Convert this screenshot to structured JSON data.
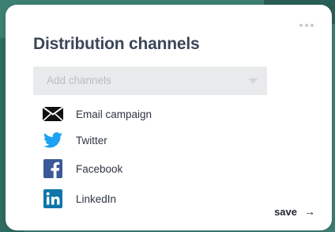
{
  "card": {
    "title": "Distribution channels"
  },
  "select": {
    "placeholder": "Add channels"
  },
  "channels": [
    {
      "label": "Email campaign",
      "icon": "envelope-icon"
    },
    {
      "label": "Twitter",
      "icon": "twitter-icon",
      "color": "#1da1f2"
    },
    {
      "label": "Facebook",
      "icon": "facebook-icon",
      "color": "#3b5998"
    },
    {
      "label": "LinkedIn",
      "icon": "linkedin-icon",
      "color": "#0e76a8"
    }
  ],
  "actions": {
    "save_label": "save",
    "save_icon": "arrow-right-icon"
  },
  "colors": {
    "background": "#3e7f74",
    "card": "#ffffff",
    "title": "#3b4658",
    "select_bg": "#e9eaeb"
  }
}
